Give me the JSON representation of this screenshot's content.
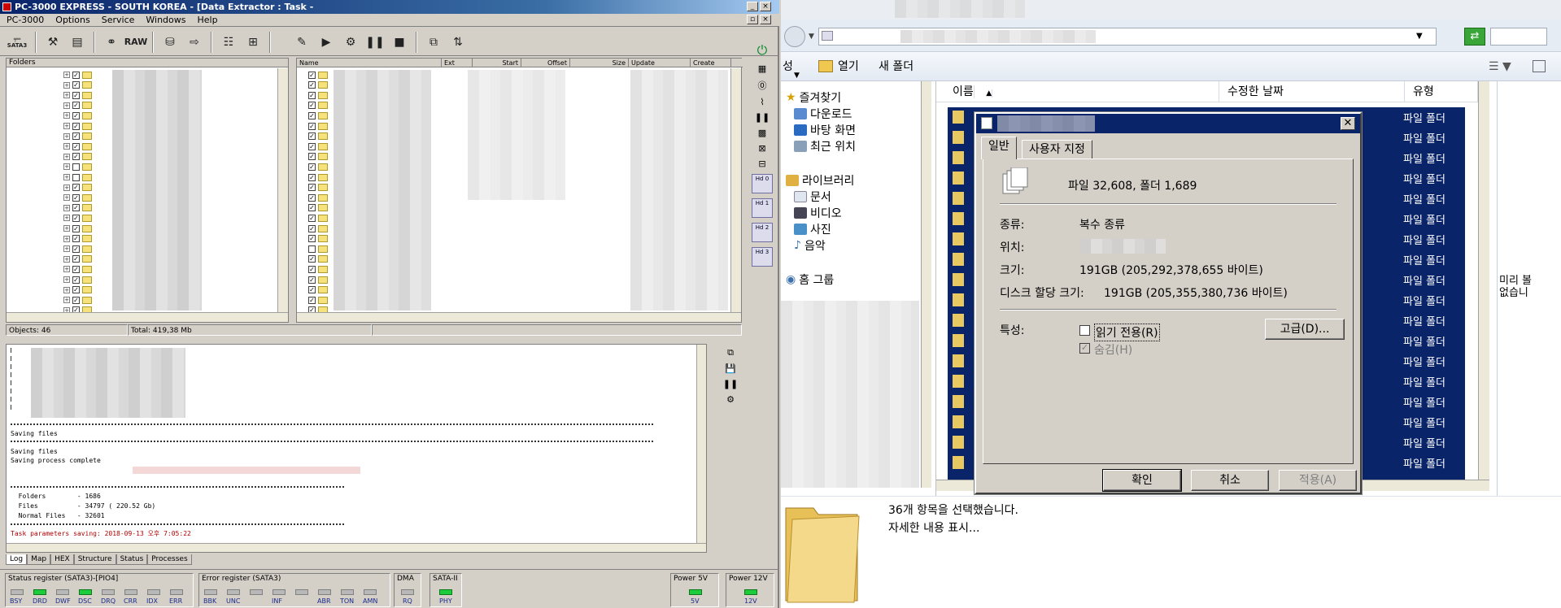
{
  "pc3000": {
    "title": "PC-3000 EXPRESS - SOUTH KOREA - [Data Extractor : Task -",
    "menu": [
      "PC-3000",
      "Options",
      "Service",
      "Windows",
      "Help"
    ],
    "toolbar": {
      "sata_label": "SATA3",
      "raw_label": "RAW"
    },
    "folders_header": "Folders",
    "file_columns": [
      "Name",
      "Ext",
      "Start",
      "Offset",
      "Size",
      "Update",
      "Create"
    ],
    "objects": "Objects: 46",
    "total": "Total: 419,38 Mb",
    "log": {
      "saving_files": "Saving files",
      "saving_files2": "Saving files",
      "complete": "Saving process complete",
      "folders_line": "  Folders        - 1686",
      "files_line": "  Files          - 34797 ( 220.52 Gb)",
      "normal_line": "  Normal Files   - 32601",
      "task_line": "Task parameters saving: 2018-09-13 오후 7:05:22"
    },
    "log_tabs": [
      "Log",
      "Map",
      "HEX",
      "Structure",
      "Status",
      "Processes"
    ],
    "status_register": {
      "title": "Status register (SATA3)-[PIO4]",
      "leds": [
        {
          "label": "BSY",
          "on": false
        },
        {
          "label": "DRD",
          "on": true
        },
        {
          "label": "DWF",
          "on": false
        },
        {
          "label": "DSC",
          "on": true
        },
        {
          "label": "DRQ",
          "on": false
        },
        {
          "label": "CRR",
          "on": false
        },
        {
          "label": "IDX",
          "on": false
        },
        {
          "label": "ERR",
          "on": false
        }
      ]
    },
    "error_register": {
      "title": "Error register (SATA3)",
      "leds": [
        {
          "label": "BBK",
          "on": false
        },
        {
          "label": "UNC",
          "on": false
        },
        {
          "label": "",
          "on": false
        },
        {
          "label": "INF",
          "on": false
        },
        {
          "label": "",
          "on": false
        },
        {
          "label": "ABR",
          "on": false
        },
        {
          "label": "TON",
          "on": false
        },
        {
          "label": "AMN",
          "on": false
        }
      ]
    },
    "dma": {
      "title": "DMA",
      "label": "RQ"
    },
    "sata2": {
      "title": "SATA-II",
      "label": "PHY"
    },
    "power5": {
      "title": "Power 5V",
      "label": "5V"
    },
    "power12": {
      "title": "Power 12V",
      "label": "12V"
    },
    "hd_buttons": [
      "Hd 0",
      "Hd 1",
      "Hd 2",
      "Hd 3"
    ]
  },
  "explorer": {
    "cmd": {
      "open": "열기",
      "new_folder": "새 폴더",
      "organize": "성"
    },
    "nav": {
      "favorites": "즐겨찾기",
      "downloads": "다운로드",
      "desktop": "바탕 화면",
      "recent": "최근 위치",
      "libraries": "라이브러리",
      "documents": "문서",
      "videos": "비디오",
      "pictures": "사진",
      "music": "음악",
      "homegroup": "홈 그룹"
    },
    "columns": {
      "name": "이름",
      "modified": "수정한 날짜",
      "type": "유형"
    },
    "row_type": "파일 폴더",
    "preview": "미리 볼\n없습니",
    "bottom": {
      "selected": "36개 항목을 선택했습니다.",
      "details": "자세한 내용 표시..."
    }
  },
  "dialog": {
    "tabs": [
      "일반",
      "사용자 지정"
    ],
    "summary": "파일 32,608, 폴더 1,689",
    "type_label": "종류:",
    "type_value": "복수 종류",
    "location_label": "위치:",
    "size_label": "크기:",
    "size_value": "191GB (205,292,378,655 바이트)",
    "disk_label": "디스크 할당 크기:",
    "disk_value": "191GB (205,355,380,736 바이트)",
    "attr_label": "특성:",
    "readonly_label": "읽기 전용(R)",
    "hidden_label": "숨김(H)",
    "advanced_button": "고급(D)...",
    "ok_button": "확인",
    "cancel_button": "취소",
    "apply_button": "적용(A)"
  }
}
